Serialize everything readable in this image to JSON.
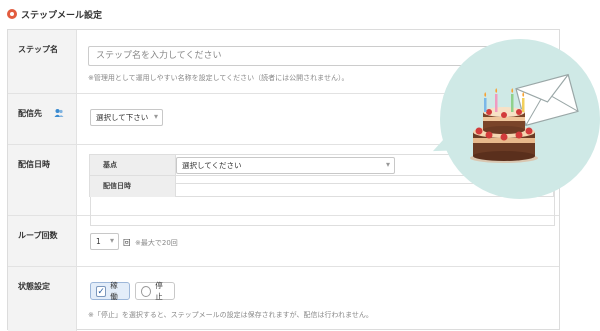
{
  "page": {
    "title": "ステップメール設定"
  },
  "form": {
    "step_name": {
      "label": "ステップ名",
      "placeholder": "ステップ名を入力してください",
      "help": "※管理用として運用しやすい名称を設定してください（読者には公開されません）。"
    },
    "source": {
      "label": "配信先",
      "select_value": "選択して下さい"
    },
    "schedule": {
      "label": "配信日時",
      "base_label": "基点",
      "base_select": "選択してください",
      "datetime_label": "配信日時"
    },
    "loop": {
      "label": "ループ回数",
      "value": "1",
      "unit": "回",
      "note": "※最大で20回"
    },
    "status": {
      "label": "状態設定",
      "options": [
        {
          "label": "稼働",
          "selected": true
        },
        {
          "label": "停止",
          "selected": false
        }
      ],
      "help": "※「停止」を選択すると、ステップメールの設定は保存されますが、配信は行われません。"
    }
  },
  "icons": {
    "header": "circle-bullet-icon",
    "source": "group-icon",
    "select_arrow": "arrow-down-icon",
    "check": "checkmark-icon"
  },
  "colors": {
    "accent": "#e25c3f",
    "bubble": "#cfe9e6",
    "active_toggle": "#e3edf9"
  }
}
